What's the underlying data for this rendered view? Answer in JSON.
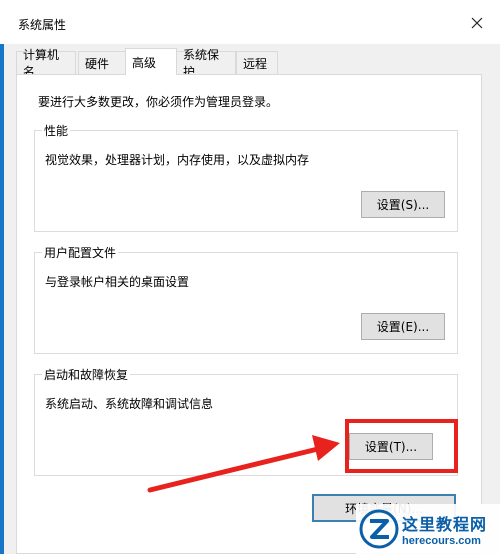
{
  "window": {
    "title": "系统属性"
  },
  "tabs": [
    {
      "label": "计算机名",
      "active": false
    },
    {
      "label": "硬件",
      "active": false
    },
    {
      "label": "高级",
      "active": true
    },
    {
      "label": "系统保护",
      "active": false
    },
    {
      "label": "远程",
      "active": false
    }
  ],
  "advanced": {
    "intro": "要进行大多数更改，你必须作为管理员登录。",
    "performance": {
      "title": "性能",
      "description": "视觉效果，处理器计划，内存使用，以及虚拟内存",
      "button": "设置(S)..."
    },
    "user_profiles": {
      "title": "用户配置文件",
      "description": "与登录帐户相关的桌面设置",
      "button": "设置(E)..."
    },
    "startup_recovery": {
      "title": "启动和故障恢复",
      "description": "系统启动、系统故障和调试信息",
      "button": "设置(T)..."
    },
    "env_button": "环境变量(N)..."
  },
  "watermark": {
    "name": "这里教程网",
    "url": "herecours.com"
  },
  "colors": {
    "highlight": "#e8221c",
    "accent": "#0b5fa8"
  }
}
